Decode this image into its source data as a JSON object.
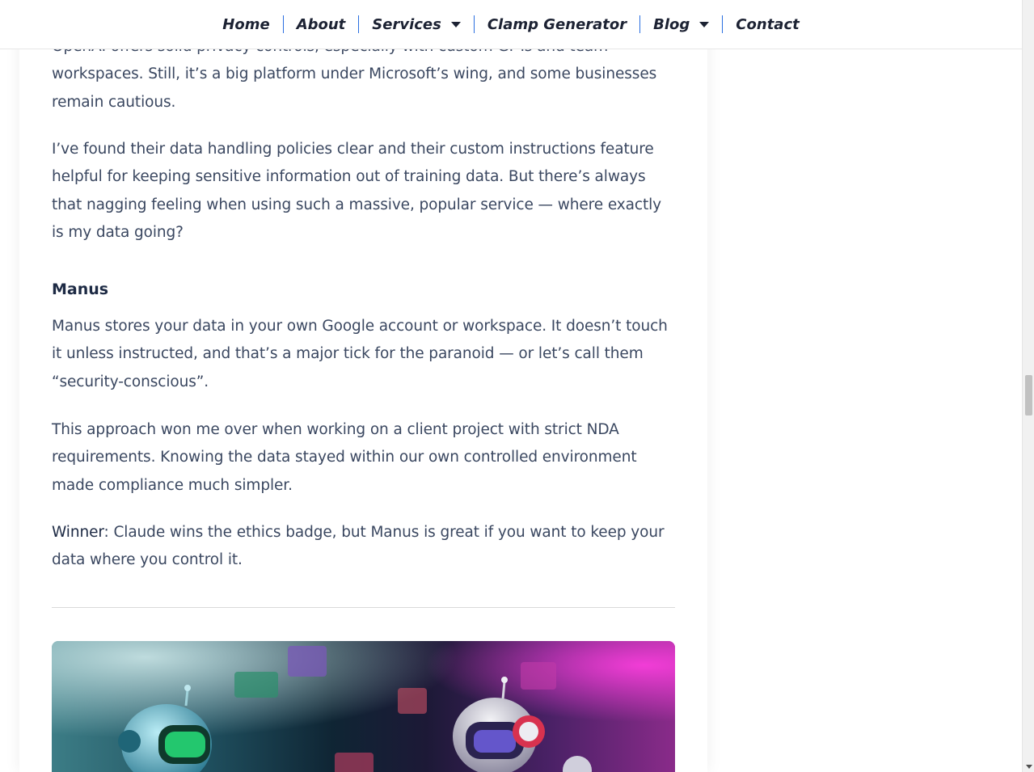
{
  "nav": {
    "items": [
      {
        "label": "Home",
        "has_dropdown": false
      },
      {
        "label": "About",
        "has_dropdown": false
      },
      {
        "label": "Services",
        "has_dropdown": true
      },
      {
        "label": "Clamp Generator",
        "has_dropdown": false
      },
      {
        "label": "Blog",
        "has_dropdown": true
      },
      {
        "label": "Contact",
        "has_dropdown": false
      }
    ],
    "separator_color": "#2a6fe0"
  },
  "article": {
    "para_openai_1": "OpenAI offers solid privacy controls, especially with custom GPTs and team workspaces. Still, it’s a big platform under Microsoft’s wing, and some businesses remain cautious.",
    "para_openai_1_line1": "OpenAI offers solid privacy controls, especially with custom GPTs and team",
    "para_openai_1_line2": "workspaces. Still, it’s a big platform under Microsoft’s wing, and some businesses",
    "para_openai_1_line3": "remain cautious.",
    "para_openai_2": "I’ve found their data handling policies clear and their custom instructions feature helpful for keeping sensitive information out of training data. But there’s always that nagging feeling when using such a massive, popular service — where exactly is my data going?",
    "heading_manus": "Manus",
    "para_manus_1": "Manus stores your data in your own Google account or workspace. It doesn’t touch it unless instructed, and that’s a major tick for the paranoid — or let’s call them “security-conscious”.",
    "para_manus_2": "This approach won me over when working on a client project with strict NDA requirements. Knowing the data stayed within our own controlled environment made compliance much simpler.",
    "winner_label": "Winner",
    "winner_text": ": Claude wins the ethics badge, but Manus is great if you want to keep your data where you control it."
  },
  "hero_image": {
    "icon": "robots-illustration"
  },
  "colors": {
    "text": "#3a4760",
    "heading": "#1d2a44",
    "nav_text": "#1c2233"
  }
}
